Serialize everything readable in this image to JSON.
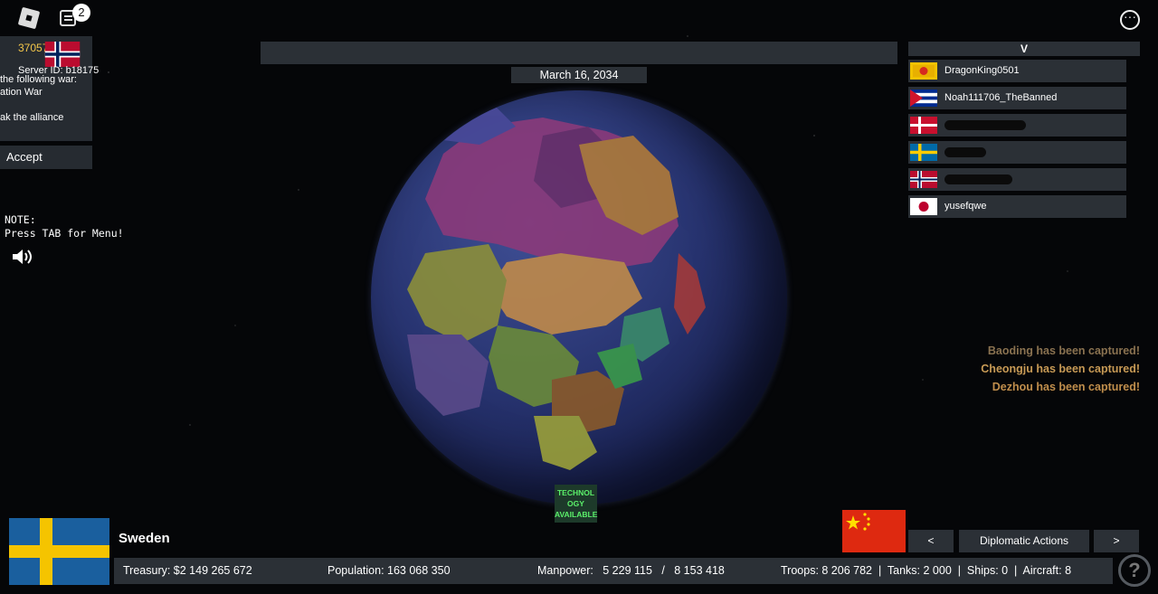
{
  "topleft": {
    "chat_badge": "2"
  },
  "dialog": {
    "xp": "3705762 XP",
    "server_id": "Server ID: b18175",
    "lines": [
      "the following war:",
      "ation War",
      "ak the alliance"
    ],
    "accept_label": "Accept"
  },
  "note": "NOTE:\nPress TAB for Menu!",
  "date": "March 16, 2034",
  "tech_label": "TECHNOL OGY AVAILABLE",
  "player_list": {
    "header": "V",
    "players": [
      {
        "name": "DragonKing0501",
        "flag": "yellow-sun-flag"
      },
      {
        "name": "Noah111706_TheBanned",
        "flag": "cuba-flag"
      },
      {
        "name": "",
        "flag": "denmark-flag"
      },
      {
        "name": "",
        "flag": "sweden-flag"
      },
      {
        "name": "",
        "flag": "norway-flag"
      },
      {
        "name": "yusefqwe",
        "flag": "japan-flag"
      }
    ]
  },
  "notifications": [
    {
      "text": "Baoding has been captured!",
      "color": "#8a7250"
    },
    {
      "text": "Cheongju has been captured!",
      "color": "#c79a55"
    },
    {
      "text": "Dezhou has been captured!",
      "color": "#c08e4c"
    }
  ],
  "country": {
    "name": "Sweden"
  },
  "nav": {
    "prev": "<",
    "diplomatic": "Diplomatic Actions",
    "next": ">"
  },
  "stats": {
    "treasury": "Treasury:   $2 149 265 672",
    "population": "Population: 163 068 350",
    "manpower": "Manpower:   5 229 115   /   8 153 418",
    "military": "Troops: 8 206 782  |  Tanks: 2 000  |  Ships: 0  |  Aircraft: 8"
  },
  "help_label": "?"
}
